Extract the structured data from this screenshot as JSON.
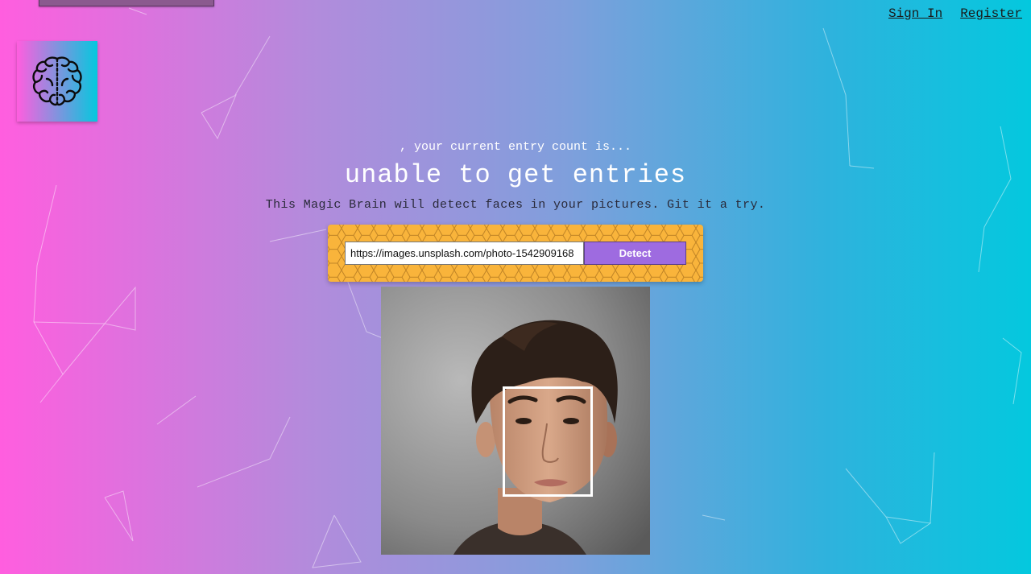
{
  "nav": {
    "sign_in": "Sign In",
    "register": "Register"
  },
  "logo": {
    "icon": "brain-icon"
  },
  "rank": {
    "text": ", your current entry count is..."
  },
  "entries": {
    "text": "unable to get entries"
  },
  "tagline": {
    "text": "This Magic Brain will detect faces in your pictures. Git it a try."
  },
  "form": {
    "url_value": "https://images.unsplash.com/photo-1542909168",
    "detect_label": "Detect"
  },
  "photo": {
    "face_detected": true
  },
  "colors": {
    "gradient_left": "#ff5edf",
    "gradient_right": "#04c8de",
    "form_panel": "#f9b43b",
    "detect_button": "#9e6be0",
    "face_box": "#ffffff"
  }
}
